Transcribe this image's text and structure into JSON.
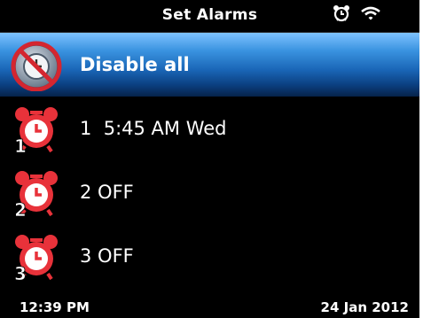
{
  "header": {
    "title": "Set Alarms",
    "status_icons": [
      "alarm-clock-icon",
      "wifi-icon"
    ]
  },
  "list": {
    "items": [
      {
        "label": "Disable all",
        "icon": "disable-alarms-icon",
        "selected": true
      },
      {
        "label": "1  5:45 AM Wed",
        "icon": "alarm-clock-icon",
        "badge": "1"
      },
      {
        "label": "2 OFF",
        "icon": "alarm-clock-icon",
        "badge": "2"
      },
      {
        "label": "3 OFF",
        "icon": "alarm-clock-icon",
        "badge": "3"
      }
    ]
  },
  "footer": {
    "time": "12:39 PM",
    "date": "24 Jan 2012"
  },
  "colors": {
    "background": "#000000",
    "selection_blue": "#1a66b7",
    "alarm_red": "#e8323a",
    "text": "#ffffff"
  }
}
